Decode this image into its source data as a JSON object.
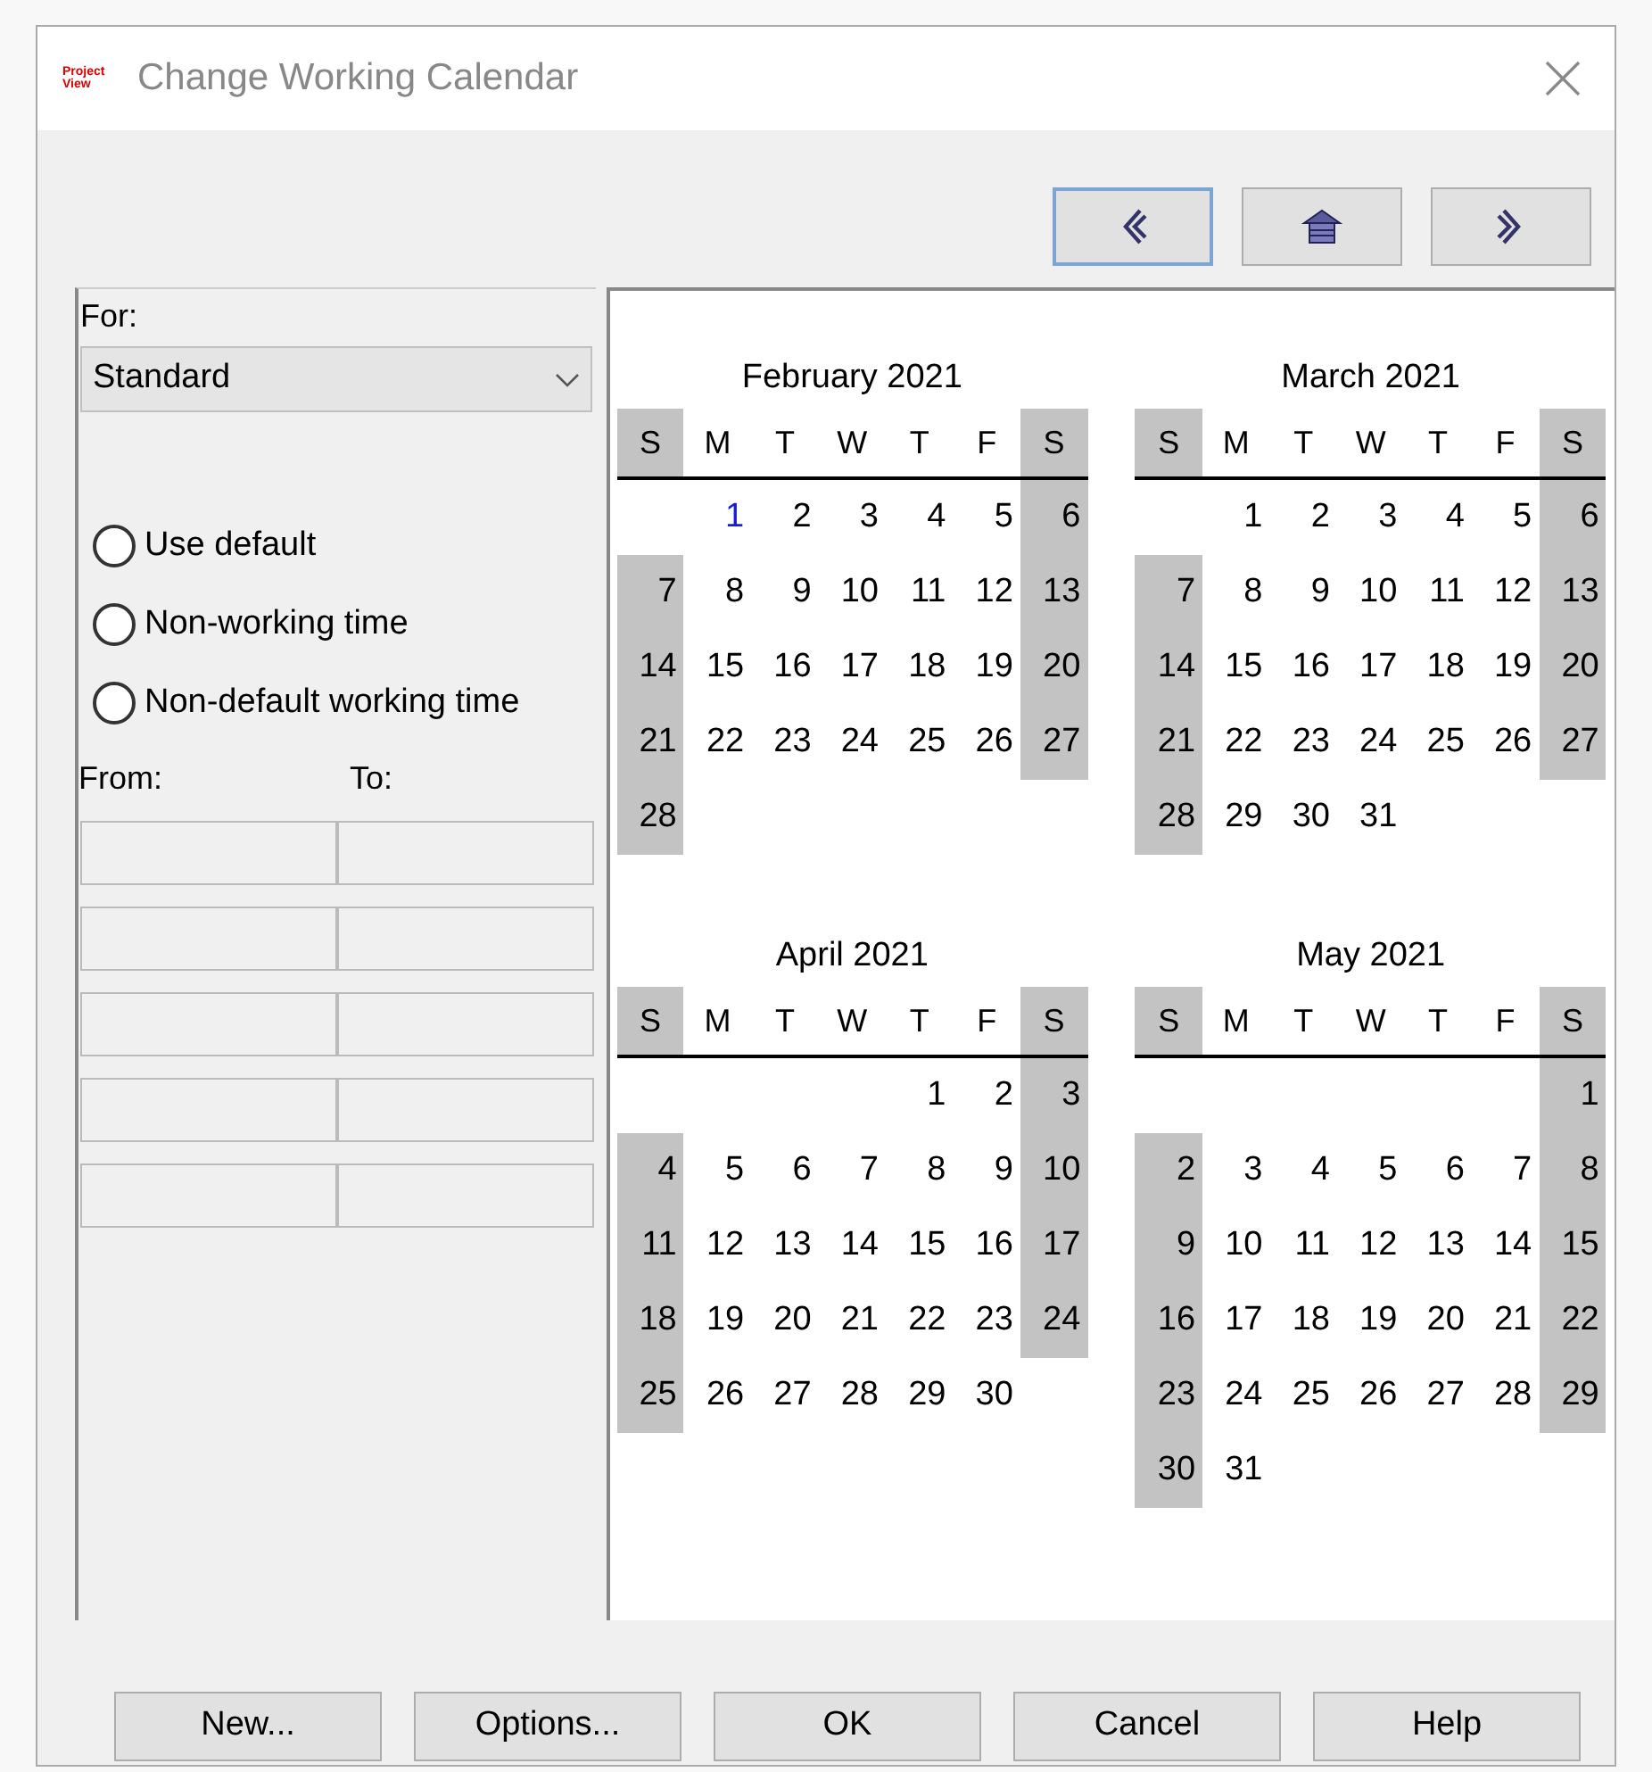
{
  "window": {
    "title": "Change Working Calendar",
    "logo": "Project View"
  },
  "nav_buttons": [
    {
      "kind": "prev",
      "focused": true
    },
    {
      "kind": "home",
      "focused": false
    },
    {
      "kind": "next",
      "focused": false
    }
  ],
  "for_label": "For:",
  "calendar_select": {
    "value": "Standard"
  },
  "options": [
    {
      "label": "Use default",
      "selected": false
    },
    {
      "label": "Non-working time",
      "selected": false
    },
    {
      "label": "Non-default working time",
      "selected": false
    }
  ],
  "from_label": "From:",
  "to_label": "To:",
  "months": [
    {
      "title": "February 2021",
      "weekdays": [
        "S",
        "M",
        "T",
        "W",
        "T",
        "F",
        "S"
      ],
      "weeks": [
        [
          {
            "day": "1",
            "today": true
          },
          "2",
          "3",
          "4",
          "5",
          "6"
        ],
        [
          "7",
          "8",
          "9",
          "10",
          "11",
          "12",
          "13"
        ],
        [
          "14",
          "15",
          "16",
          "17",
          "18",
          "19",
          "20"
        ],
        [
          "21",
          "22",
          "23",
          "24",
          "25",
          "26",
          "27"
        ],
        [
          "28"
        ]
      ]
    },
    {
      "title": "March 2021",
      "weekdays": [
        "S",
        "M",
        "T",
        "W",
        "T",
        "F",
        "S"
      ],
      "weeks": [
        [
          "1",
          "2",
          "3",
          "4",
          "5",
          "6"
        ],
        [
          "7",
          "8",
          "9",
          "10",
          "11",
          "12",
          "13"
        ],
        [
          "14",
          "15",
          "16",
          "17",
          "18",
          "19",
          "20"
        ],
        [
          "21",
          "22",
          "23",
          "24",
          "25",
          "26",
          "27"
        ],
        [
          "28",
          "29",
          "30",
          "31"
        ]
      ]
    },
    {
      "title": "April 2021",
      "weekdays": [
        "S",
        "M",
        "T",
        "W",
        "T",
        "F",
        "S"
      ],
      "weeks": [
        [
          "1",
          "2",
          "3"
        ],
        [
          "4",
          "5",
          "6",
          "7",
          "8",
          "9",
          "10"
        ],
        [
          "11",
          "12",
          "13",
          "14",
          "15",
          "16",
          "17"
        ],
        [
          "18",
          "19",
          "20",
          "21",
          "22",
          "23",
          "24"
        ],
        [
          "25",
          "26",
          "27",
          "28",
          "29",
          "30"
        ]
      ]
    },
    {
      "title": "May 2021",
      "weekdays": [
        "S",
        "M",
        "T",
        "W",
        "T",
        "F",
        "S"
      ],
      "weeks": [
        [
          "1"
        ],
        [
          "2",
          "3",
          "4",
          "5",
          "6",
          "7",
          "8"
        ],
        [
          "9",
          "10",
          "11",
          "12",
          "13",
          "14",
          "15"
        ],
        [
          "16",
          "17",
          "18",
          "19",
          "20",
          "21",
          "22"
        ],
        [
          "23",
          "24",
          "25",
          "26",
          "27",
          "28",
          "29"
        ],
        [
          "30",
          "31"
        ]
      ]
    }
  ],
  "buttons": [
    "New...",
    "Options...",
    "OK",
    "Cancel",
    "Help"
  ]
}
